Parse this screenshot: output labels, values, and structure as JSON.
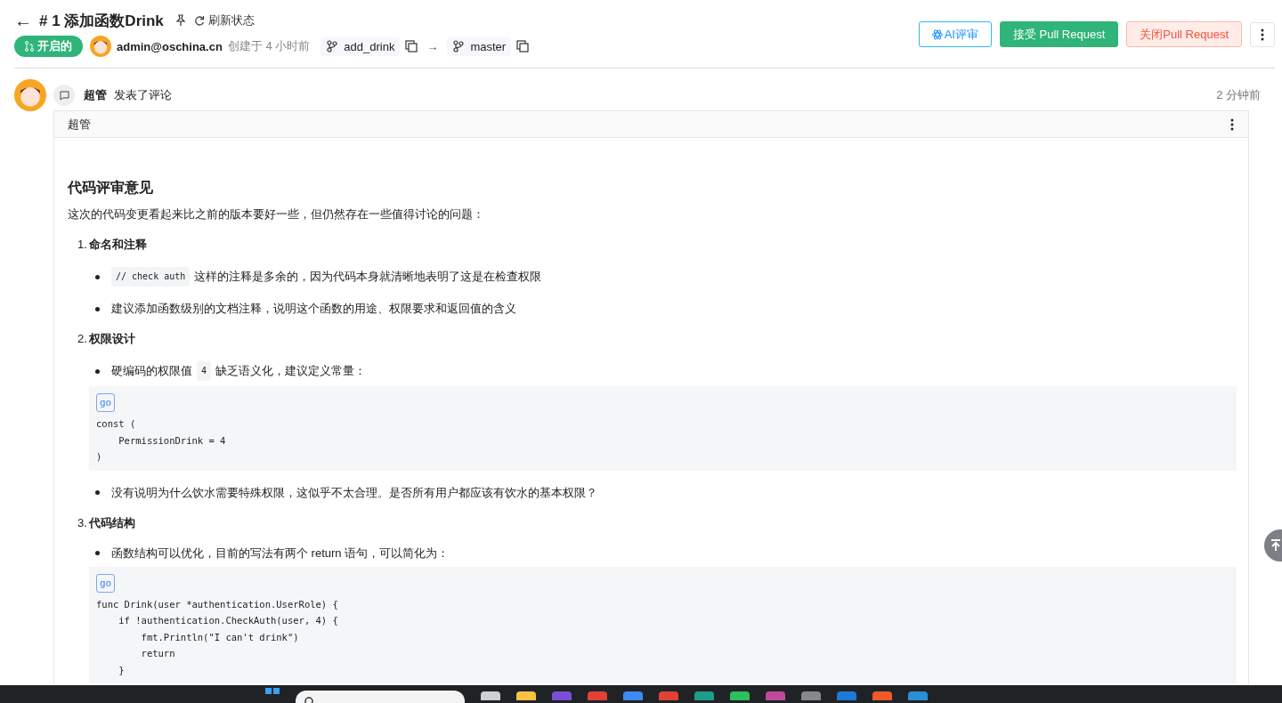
{
  "header": {
    "back": "←",
    "title": "# 1 添加函数Drink",
    "refresh": "刷新状态",
    "status": {
      "label": "开启的",
      "kind": "open"
    },
    "author": "admin@oschina.cn",
    "created": "创建于 4 小时前",
    "source_branch": "add_drink",
    "target_branch": "master",
    "arrow": "→",
    "buttons": [
      {
        "label": "AI评审",
        "kind": "ai"
      },
      {
        "label": "接受 Pull Request",
        "kind": "accept"
      },
      {
        "label": "关闭Pull Request",
        "kind": "close"
      }
    ]
  },
  "comment": {
    "author": "超管",
    "action": "发表了评论",
    "time": "2 分钟前",
    "card_title": "超管",
    "heading": "代码评审意见",
    "intro": "这次的代码变更看起来比之前的版本要好一些，但仍然存在一些值得讨论的问题：",
    "sections": [
      {
        "number": "1.",
        "title": "命名和注释",
        "blocks": [
          {
            "kind": "bullet",
            "segments": [
              {
                "kind": "code",
                "text": "// check auth"
              },
              {
                "kind": "text",
                "text": "这样的注释是多余的，因为代码本身就清晰地表明了这是在检查权限"
              }
            ]
          },
          {
            "kind": "bullet",
            "segments": [
              {
                "kind": "text",
                "text": "建议添加函数级别的文档注释，说明这个函数的用途、权限要求和返回值的含义"
              }
            ]
          }
        ]
      },
      {
        "number": "2.",
        "title": "权限设计",
        "blocks": [
          {
            "kind": "bullet",
            "segments": [
              {
                "kind": "text",
                "text": "硬编码的权限值"
              },
              {
                "kind": "code",
                "text": "4"
              },
              {
                "kind": "text",
                "text": "缺乏语义化，建议定义常量："
              }
            ]
          },
          {
            "kind": "codeblock",
            "lang": "go",
            "lines": [
              "const (",
              "    PermissionDrink = 4",
              ")"
            ]
          },
          {
            "kind": "bullet",
            "segments": [
              {
                "kind": "text",
                "text": "没有说明为什么饮水需要特殊权限，这似乎不太合理。是否所有用户都应该有饮水的基本权限？"
              }
            ]
          }
        ]
      },
      {
        "number": "3.",
        "title": "代码结构",
        "blocks": [
          {
            "kind": "bullet",
            "segments": [
              {
                "kind": "text",
                "text": "函数结构可以优化，目前的写法有两个 return 语句，可以简化为："
              }
            ]
          },
          {
            "kind": "codeblock",
            "lang": "go",
            "lines": [
              "func Drink(user *authentication.UserRole) {",
              "    if !authentication.CheckAuth(user, 4) {",
              "        fmt.Println(\"I can't drink\")",
              "        return",
              "    }"
            ]
          }
        ]
      }
    ]
  }
}
